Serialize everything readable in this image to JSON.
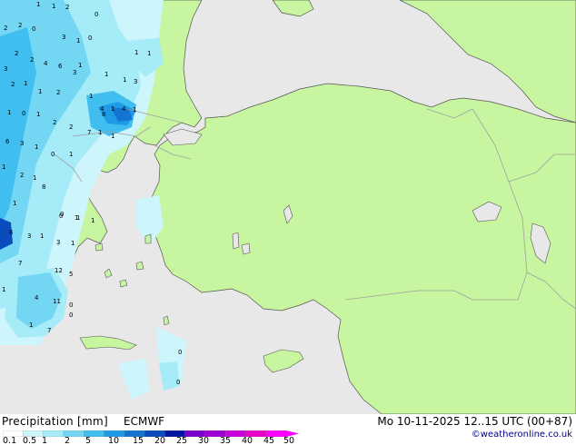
{
  "title": "Precipitation [mm]",
  "model": "ECMWF",
  "datetime": "Mo 10-11-2025 12..15 UTC (00+87)",
  "credit": "©weatheronline.co.uk",
  "colors": {
    "land": "#c8f5a0",
    "sea": "#e8e8e8",
    "border": "#a0a0a0",
    "coast": "#555555"
  },
  "legend": {
    "ticks": [
      "0.1",
      "0.5",
      "1",
      "2",
      "5",
      "10",
      "15",
      "20",
      "25",
      "30",
      "35",
      "40",
      "45",
      "50"
    ],
    "colors": [
      "#ffffff",
      "#cdf5fc",
      "#a5ebf8",
      "#73d7f3",
      "#41bef0",
      "#1e9be6",
      "#1474d2",
      "#0a4cbe",
      "#0014a0",
      "#7800c8",
      "#a000d2",
      "#c800dc",
      "#e600c8",
      "#ff00ff"
    ]
  },
  "map_values": [
    "1",
    "1",
    "2",
    "0",
    "2",
    "2",
    "0",
    "3",
    "0",
    "1",
    "2",
    "2",
    "4",
    "3",
    "6",
    "1",
    "1",
    "1",
    "1",
    "3",
    "2",
    "1",
    "1",
    "2",
    "1",
    "1",
    "3",
    "4",
    "8",
    "1",
    "4",
    "1",
    "1",
    "0",
    "1",
    "2",
    "2",
    "7",
    "1",
    "1",
    "6",
    "3",
    "1",
    "0",
    "1",
    "1",
    "2",
    "1",
    "8",
    "1",
    "0",
    "1",
    "1",
    "6",
    "3",
    "1",
    "7",
    "12",
    "5",
    "4",
    "11",
    "0",
    "1",
    "7",
    "1",
    "0",
    "0",
    "0",
    "0",
    "1",
    "3",
    "1"
  ]
}
